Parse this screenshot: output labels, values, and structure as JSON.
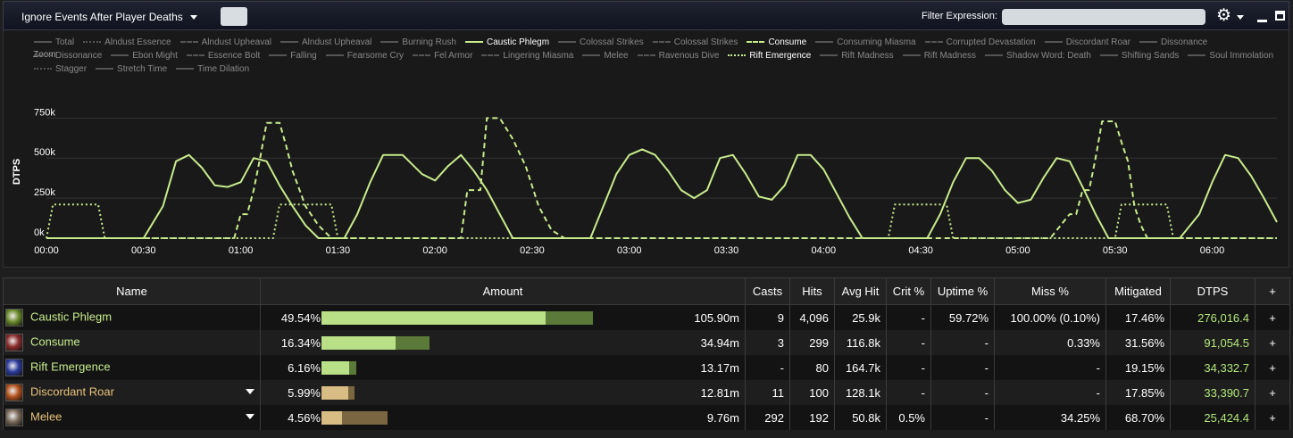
{
  "toolbar": {
    "deaths_dropdown": "Ignore Events After Player Deaths",
    "filter_label": "Filter Expression:",
    "filter_value": "",
    "filter_placeholder": ""
  },
  "chart_data": {
    "type": "line",
    "title": "",
    "zoom_label": "Zoom",
    "ylabel": "DTPS",
    "xlabel": "",
    "ylim": [
      0,
      830000
    ],
    "xlim": [
      0,
      380
    ],
    "yticks": [
      {
        "v": 0,
        "label": "0k"
      },
      {
        "v": 250000,
        "label": "250k"
      },
      {
        "v": 500000,
        "label": "500k"
      },
      {
        "v": 750000,
        "label": "750k"
      }
    ],
    "xticks": [
      {
        "v": 0,
        "label": "00:00"
      },
      {
        "v": 30,
        "label": "00:30"
      },
      {
        "v": 60,
        "label": "01:00"
      },
      {
        "v": 90,
        "label": "01:30"
      },
      {
        "v": 120,
        "label": "02:00"
      },
      {
        "v": 150,
        "label": "02:30"
      },
      {
        "v": 180,
        "label": "03:00"
      },
      {
        "v": 210,
        "label": "03:30"
      },
      {
        "v": 240,
        "label": "04:00"
      },
      {
        "v": 270,
        "label": "04:30"
      },
      {
        "v": 300,
        "label": "05:00"
      },
      {
        "v": 330,
        "label": "05:30"
      },
      {
        "v": 360,
        "label": "06:00"
      }
    ],
    "grid": true,
    "legend_position": "top",
    "legend": [
      {
        "name": "Total",
        "dash": "solid",
        "active": false
      },
      {
        "name": "Alndust Essence",
        "dash": "dotted",
        "active": false
      },
      {
        "name": "Alndust Upheaval",
        "dash": "dashdot",
        "active": false
      },
      {
        "name": "Alndust Upheaval",
        "dash": "solid",
        "active": false
      },
      {
        "name": "Burning Rush",
        "dash": "solid",
        "active": false
      },
      {
        "name": "Caustic Phlegm",
        "dash": "solid",
        "active": true
      },
      {
        "name": "Colossal Strikes",
        "dash": "solid",
        "active": false
      },
      {
        "name": "Colossal Strikes",
        "dash": "dashdotdot",
        "active": false
      },
      {
        "name": "Consume",
        "dash": "dashed",
        "active": true
      },
      {
        "name": "Consuming Miasma",
        "dash": "solid",
        "active": false
      },
      {
        "name": "Corrupted Devastation",
        "dash": "dashdot",
        "active": false
      },
      {
        "name": "Discordant Roar",
        "dash": "solid",
        "active": false
      },
      {
        "name": "Dissonance",
        "dash": "solid",
        "active": false
      },
      {
        "name": "Dissonance",
        "dash": "dashdot",
        "active": false
      },
      {
        "name": "Ebon Might",
        "dash": "solid",
        "active": false
      },
      {
        "name": "Essence Bolt",
        "dash": "dashdotdot",
        "active": false
      },
      {
        "name": "Falling",
        "dash": "solid",
        "active": false
      },
      {
        "name": "Fearsome Cry",
        "dash": "solid",
        "active": false
      },
      {
        "name": "Fel Armor",
        "dash": "dashdot",
        "active": false
      },
      {
        "name": "Lingering Miasma",
        "dash": "dashdotdot",
        "active": false
      },
      {
        "name": "Melee",
        "dash": "solid",
        "active": false
      },
      {
        "name": "Ravenous Dive",
        "dash": "dashdot",
        "active": false
      },
      {
        "name": "Rift Emergence",
        "dash": "dotted",
        "active": true
      },
      {
        "name": "Rift Madness",
        "dash": "solid",
        "active": false
      },
      {
        "name": "Rift Madness",
        "dash": "solid",
        "active": false
      },
      {
        "name": "Shadow Word: Death",
        "dash": "solid",
        "active": false
      },
      {
        "name": "Shifting Sands",
        "dash": "solid",
        "active": false
      },
      {
        "name": "Soul Immolation",
        "dash": "solid",
        "active": false
      },
      {
        "name": "Stagger",
        "dash": "dotted",
        "active": false
      },
      {
        "name": "Stretch Time",
        "dash": "solid",
        "active": false
      },
      {
        "name": "Time Dilation",
        "dash": "solid",
        "active": false
      }
    ],
    "series": [
      {
        "name": "Caustic Phlegm",
        "color": "#c8ec8c",
        "dash": "solid",
        "x": [
          0,
          6,
          12,
          18,
          24,
          30,
          36,
          40,
          44,
          48,
          52,
          56,
          60,
          64,
          68,
          72,
          76,
          80,
          84,
          88,
          92,
          96,
          100,
          104,
          110,
          116,
          120,
          124,
          128,
          132,
          136,
          140,
          144,
          148,
          152,
          156,
          160,
          164,
          168,
          172,
          176,
          180,
          184,
          188,
          192,
          196,
          200,
          204,
          208,
          212,
          216,
          220,
          224,
          228,
          232,
          236,
          240,
          244,
          248,
          252,
          256,
          260,
          264,
          268,
          272,
          276,
          280,
          284,
          288,
          292,
          296,
          300,
          304,
          308,
          312,
          316,
          320,
          324,
          328,
          332,
          336,
          340,
          344,
          350,
          356,
          360,
          364,
          368,
          372,
          376,
          380
        ],
        "y": [
          0,
          0,
          0,
          0,
          0,
          0,
          200000,
          480000,
          520000,
          440000,
          330000,
          320000,
          350000,
          500000,
          480000,
          330000,
          200000,
          80000,
          0,
          0,
          0,
          150000,
          350000,
          520000,
          520000,
          400000,
          360000,
          450000,
          520000,
          420000,
          300000,
          150000,
          0,
          0,
          0,
          0,
          0,
          0,
          0,
          200000,
          400000,
          520000,
          555000,
          520000,
          420000,
          300000,
          250000,
          300000,
          500000,
          520000,
          400000,
          260000,
          240000,
          330000,
          520000,
          520000,
          430000,
          280000,
          130000,
          0,
          0,
          0,
          0,
          0,
          0,
          150000,
          350000,
          500000,
          500000,
          420000,
          300000,
          220000,
          240000,
          380000,
          500000,
          480000,
          320000,
          150000,
          0,
          0,
          0,
          0,
          0,
          0,
          150000,
          350000,
          520000,
          500000,
          390000,
          250000,
          100000
        ]
      },
      {
        "name": "Consume",
        "color": "#c8ec8c",
        "dash": "6,4",
        "x": [
          0,
          56,
          58,
          60,
          62,
          64,
          66,
          68,
          70,
          72,
          74,
          76,
          80,
          84,
          88,
          92,
          94,
          100,
          110,
          115,
          120,
          124,
          126,
          128,
          130,
          132,
          134,
          136,
          138,
          140,
          144,
          148,
          152,
          156,
          160,
          200,
          240,
          280,
          300,
          310,
          316,
          318,
          320,
          322,
          324,
          326,
          328,
          330,
          332,
          334,
          336,
          338,
          340,
          344,
          350,
          380
        ],
        "y": [
          0,
          0,
          0,
          150000,
          150000,
          300000,
          500000,
          720000,
          720000,
          720000,
          580000,
          420000,
          200000,
          80000,
          0,
          0,
          0,
          0,
          0,
          0,
          0,
          0,
          0,
          0,
          300000,
          300000,
          300000,
          750000,
          750000,
          750000,
          620000,
          450000,
          200000,
          50000,
          0,
          0,
          0,
          0,
          0,
          0,
          150000,
          150000,
          300000,
          300000,
          500000,
          730000,
          730000,
          730000,
          600000,
          480000,
          200000,
          80000,
          0,
          0,
          0,
          0
        ]
      },
      {
        "name": "Rift Emergence",
        "color": "#c8ec8c",
        "dash": "2,3",
        "x": [
          0,
          2,
          4,
          14,
          16,
          18,
          70,
          72,
          74,
          86,
          88,
          90,
          144,
          240,
          260,
          262,
          264,
          276,
          278,
          280,
          300,
          330,
          332,
          334,
          344,
          346,
          348,
          380
        ],
        "y": [
          0,
          210000,
          210000,
          210000,
          210000,
          0,
          0,
          210000,
          210000,
          210000,
          210000,
          0,
          0,
          0,
          0,
          210000,
          210000,
          210000,
          210000,
          0,
          0,
          0,
          210000,
          210000,
          210000,
          210000,
          0,
          0
        ]
      }
    ]
  },
  "table": {
    "columns": [
      "Name",
      "Amount",
      "Casts",
      "Hits",
      "Avg Hit",
      "Crit %",
      "Uptime %",
      "Miss %",
      "Mitigated",
      "DTPS",
      "+"
    ],
    "rows": [
      {
        "icon": "caustic-phlegm-icon",
        "icon_color": "#6b8a2a",
        "name": "Caustic Phlegm",
        "name_color": "#c8ec8c",
        "expand": false,
        "pct": "49.54%",
        "bar_light": "#b9e086",
        "bar_dark": "#5b7a3a",
        "fill": 0.4954,
        "mit_fill": 0.1746,
        "amount": "105.90m",
        "casts": "9",
        "hits": "4,096",
        "avg": "25.9k",
        "crit": "-",
        "uptime": "59.72%",
        "miss": "100.00% (0.10%)",
        "mitigated": "17.46%",
        "dtps": "276,016.4",
        "plus": "+"
      },
      {
        "icon": "consume-icon",
        "icon_color": "#8a2a2a",
        "name": "Consume",
        "name_color": "#c8ec8c",
        "expand": false,
        "pct": "16.34%",
        "bar_light": "#b9e086",
        "bar_dark": "#5b7a3a",
        "fill": 0.1634,
        "mit_fill": 0.3156,
        "amount": "34.94m",
        "casts": "3",
        "hits": "299",
        "avg": "116.8k",
        "crit": "-",
        "uptime": "-",
        "miss": "0.33%",
        "mitigated": "31.56%",
        "dtps": "91,054.5",
        "plus": "+"
      },
      {
        "icon": "rift-emergence-icon",
        "icon_color": "#2a3a9a",
        "name": "Rift Emergence",
        "name_color": "#c8ec8c",
        "expand": false,
        "pct": "6.16%",
        "bar_light": "#b9e086",
        "bar_dark": "#5b7a3a",
        "fill": 0.0616,
        "mit_fill": 0.1915,
        "amount": "13.17m",
        "casts": "-",
        "hits": "80",
        "avg": "164.7k",
        "crit": "-",
        "uptime": "-",
        "miss": "-",
        "mitigated": "19.15%",
        "dtps": "34,332.7",
        "plus": "+"
      },
      {
        "icon": "discordant-roar-icon",
        "icon_color": "#b3501a",
        "name": "Discordant Roar",
        "name_color": "#e8c27a",
        "expand": true,
        "pct": "5.99%",
        "bar_light": "#d7bc84",
        "bar_dark": "#7a6640",
        "fill": 0.0599,
        "mit_fill": 0.1785,
        "amount": "12.81m",
        "casts": "11",
        "hits": "100",
        "avg": "128.1k",
        "crit": "-",
        "uptime": "-",
        "miss": "-",
        "mitigated": "17.85%",
        "dtps": "33,390.7",
        "plus": "+"
      },
      {
        "icon": "melee-icon",
        "icon_color": "#7a6a5a",
        "name": "Melee",
        "name_color": "#e8c27a",
        "expand": true,
        "pct": "4.56%",
        "bar_light": "#d7bc84",
        "bar_dark": "#7a6640",
        "fill": 0.0456,
        "mit_fill": 0.687,
        "amount": "9.76m",
        "casts": "292",
        "hits": "192",
        "avg": "50.8k",
        "crit": "0.5%",
        "uptime": "-",
        "miss": "34.25%",
        "mitigated": "68.70%",
        "dtps": "25,424.4",
        "plus": "+"
      }
    ]
  }
}
